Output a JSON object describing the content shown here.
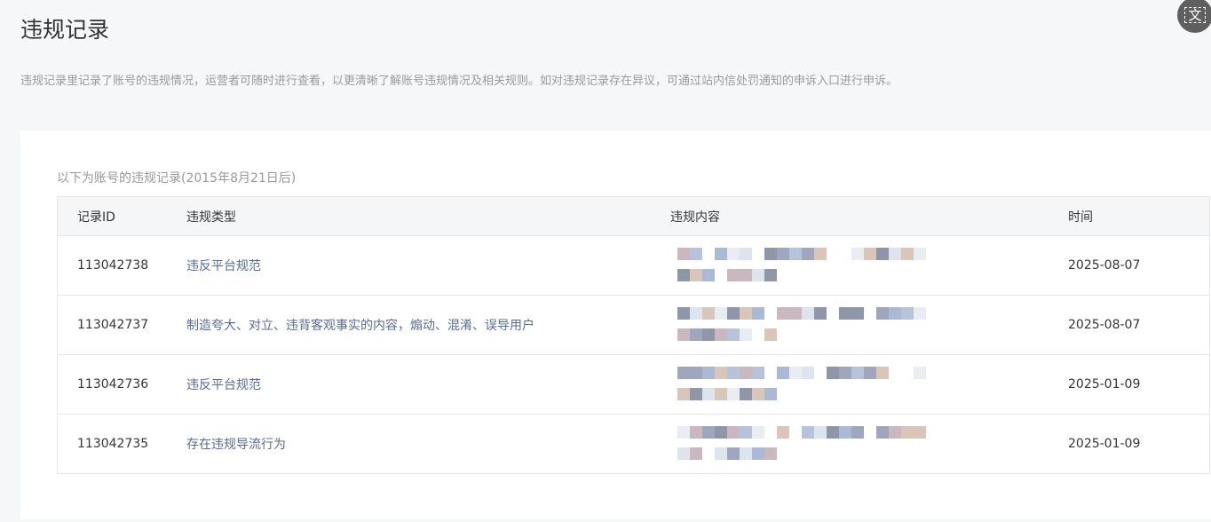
{
  "page": {
    "title": "违规记录",
    "description": "违规记录里记录了账号的违规情况，运营者可随时进行查看，以更清晰了解账号违规情况及相关规则。如对违规记录存在异议，可通过站内信处罚通知的申诉入口进行申诉。",
    "translate_icon_label": "文"
  },
  "records": {
    "caption": "以下为账号的违规记录(2015年8月21日后)",
    "columns": [
      "记录ID",
      "违规类型",
      "违规内容",
      "时间"
    ],
    "rows": [
      {
        "id": "113042738",
        "type": "违反平台规范",
        "time": "2025-08-07"
      },
      {
        "id": "113042737",
        "type": "制造夸大、对立、违背客观事实的内容，煽动、混淆、误导用户",
        "time": "2025-08-07"
      },
      {
        "id": "113042736",
        "type": "违反平台规范",
        "time": "2025-01-09"
      },
      {
        "id": "113042735",
        "type": "存在违规导流行为",
        "time": "2025-01-09"
      }
    ]
  }
}
